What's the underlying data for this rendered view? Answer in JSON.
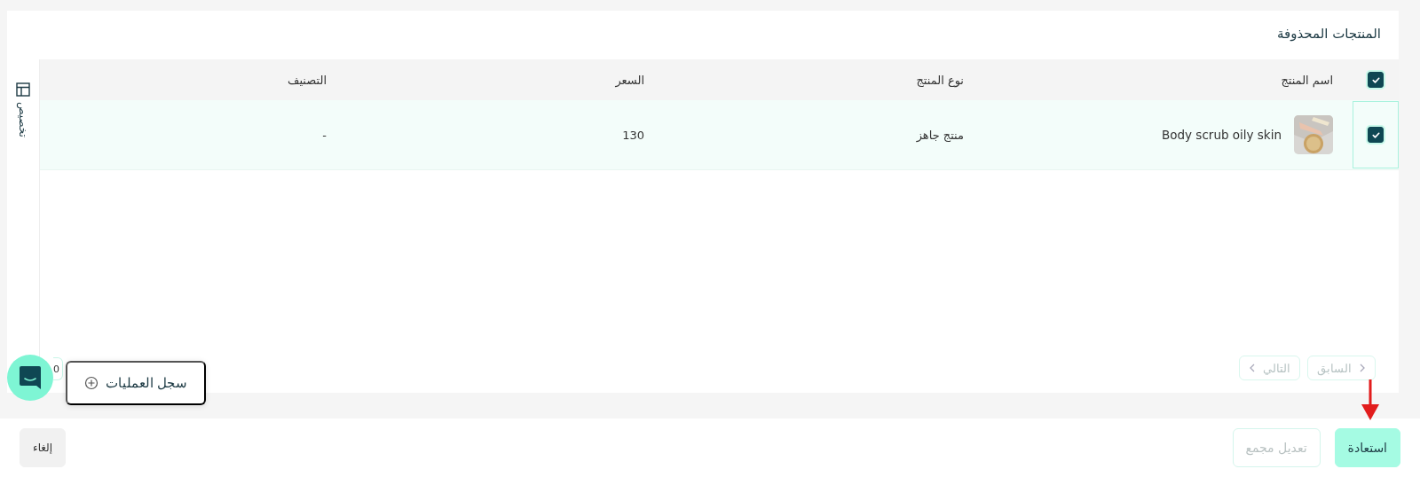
{
  "title": "المنتجات المحذوفة",
  "side_panel": {
    "label": "تخصيص"
  },
  "table": {
    "select_all": {
      "checked": true
    },
    "columns": [
      "اسم المنتج",
      "نوع المنتج",
      "السعر",
      "التصنيف"
    ],
    "rows": [
      {
        "selected": true,
        "checked": true,
        "cells": [
          "Body scrub oily skin",
          "منتج جاهز",
          "130",
          "-"
        ]
      }
    ]
  },
  "pagination": {
    "previous": {
      "label": "السابق",
      "disabled": true
    },
    "next": {
      "label": "التالي",
      "disabled": true
    }
  },
  "page_size": "0",
  "activity_log": {
    "label": "سجل العمليات"
  },
  "footer": {
    "buttons": [
      {
        "label": "استعادة",
        "kind": "primary",
        "disabled": false
      },
      {
        "label": "تعديل مجمع",
        "kind": "outline",
        "disabled": true
      },
      {
        "label": "إلغاء",
        "kind": "secondary",
        "disabled": false
      }
    ]
  }
}
